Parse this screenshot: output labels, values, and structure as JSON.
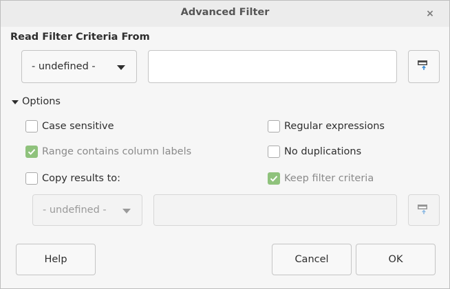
{
  "window": {
    "title": "Advanced Filter",
    "close_glyph": "×"
  },
  "read_criteria": {
    "section_title": "Read Filter Criteria From",
    "combo_value": "- undefined -",
    "range_value": "",
    "shrink_icon": "shrink-range-icon"
  },
  "options": {
    "expander_label": "Options",
    "expanded": true,
    "checkboxes": {
      "case_sensitive": {
        "label": "Case sensitive",
        "checked": false,
        "enabled": true
      },
      "regular_expressions": {
        "label": "Regular expressions",
        "checked": false,
        "enabled": true
      },
      "range_contains_labels": {
        "label": "Range contains column labels",
        "checked": true,
        "enabled": false
      },
      "no_duplications": {
        "label": "No duplications",
        "checked": false,
        "enabled": true
      },
      "copy_results": {
        "label": "Copy results to:",
        "checked": false,
        "enabled": true
      },
      "keep_filter_criteria": {
        "label": "Keep filter criteria",
        "checked": true,
        "enabled": false
      }
    },
    "copy_to": {
      "combo_value": "- undefined -",
      "range_value": "",
      "enabled": false
    }
  },
  "buttons": {
    "help": "Help",
    "cancel": "Cancel",
    "ok": "OK"
  },
  "colors": {
    "check_fill": "#8fc27c",
    "accent_icon": "#3f8fd6"
  }
}
